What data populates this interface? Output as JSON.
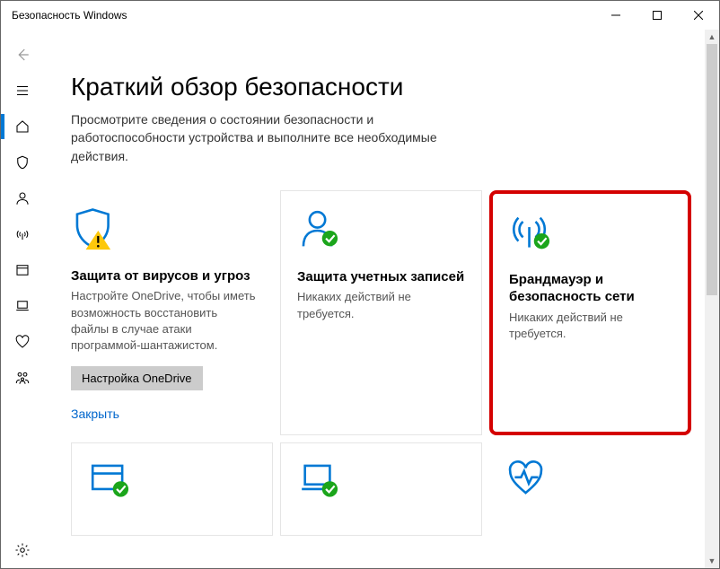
{
  "window": {
    "title": "Безопасность Windows"
  },
  "page": {
    "title": "Краткий обзор безопасности",
    "subtitle": "Просмотрите сведения о состоянии безопасности и работоспособности устройства и выполните все необходимые действия."
  },
  "cards": {
    "virus": {
      "title": "Защита от вирусов и угроз",
      "desc": "Настройте OneDrive, чтобы иметь возможность восстановить файлы в случае атаки программой-шантажистом.",
      "button": "Настройка OneDrive",
      "link": "Закрыть"
    },
    "account": {
      "title": "Защита учетных записей",
      "desc": "Никаких действий не требуется."
    },
    "firewall": {
      "title": "Брандмауэр и безопасность сети",
      "desc": "Никаких действий не требуется."
    }
  }
}
